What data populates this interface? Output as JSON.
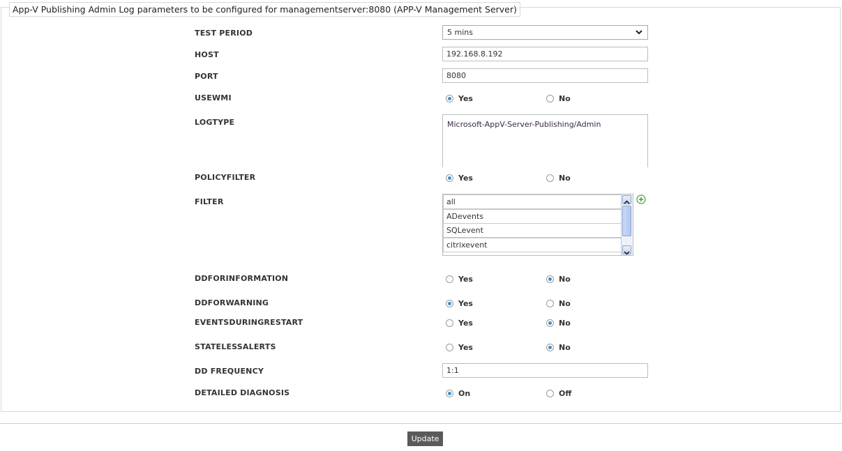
{
  "legend": "App-V Publishing Admin Log parameters to be configured for managementserver:8080 (APP-V Management Server)",
  "fields": {
    "test_period": {
      "label": "TEST PERIOD",
      "value": "5 mins"
    },
    "host": {
      "label": "HOST",
      "value": "192.168.8.192"
    },
    "port": {
      "label": "PORT",
      "value": "8080"
    },
    "usewmi": {
      "label": "USEWMI",
      "yes": "Yes",
      "no": "No",
      "selected": "Yes"
    },
    "logtype": {
      "label": "LOGTYPE",
      "value": "Microsoft-AppV-Server-Publishing/Admin"
    },
    "policyfilter": {
      "label": "POLICYFILTER",
      "yes": "Yes",
      "no": "No",
      "selected": "Yes"
    },
    "filter": {
      "label": "FILTER",
      "items": [
        "all",
        "ADevents",
        "SQLevent",
        "citrixevent"
      ]
    },
    "ddforinformation": {
      "label": "DDFORINFORMATION",
      "yes": "Yes",
      "no": "No",
      "selected": "No"
    },
    "ddforwarning": {
      "label": "DDFORWARNING",
      "yes": "Yes",
      "no": "No",
      "selected": "Yes"
    },
    "eventsduringrestart": {
      "label": "EVENTSDURINGRESTART",
      "yes": "Yes",
      "no": "No",
      "selected": "No"
    },
    "statelessalerts": {
      "label": "STATELESSALERTS",
      "yes": "Yes",
      "no": "No",
      "selected": "No"
    },
    "dd_frequency": {
      "label": "DD FREQUENCY",
      "value": "1:1"
    },
    "detailed_diagnosis": {
      "label": "DETAILED DIAGNOSIS",
      "on": "On",
      "off": "Off",
      "selected": "On"
    }
  },
  "update_label": "Update",
  "colors": {
    "radio_dot": "#3a8fd0",
    "button_bg": "#5a5a5a",
    "add_icon": "#4a9a3a"
  }
}
